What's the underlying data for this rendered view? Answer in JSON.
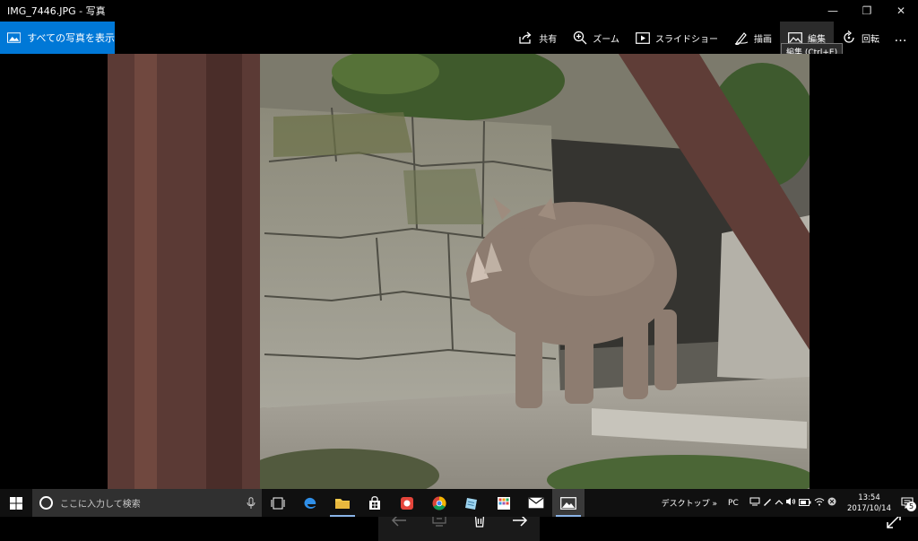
{
  "window": {
    "title": "IMG_7446.JPG - 写真",
    "minimize_glyph": "—",
    "restore_glyph": "❐",
    "close_glyph": "✕"
  },
  "toolbar": {
    "show_all_label": "すべての写真を表示",
    "share_label": "共有",
    "zoom_label": "ズーム",
    "slideshow_label": "スライドショー",
    "draw_label": "描画",
    "edit_label": "編集",
    "rotate_label": "回転",
    "more_label": "…",
    "accent_color": "#0078d7"
  },
  "tooltip": {
    "text": "編集 (Ctrl+E)"
  },
  "viewer": {
    "photo_icon": "photo-image",
    "filmstrip": {
      "prev_icon": "arrow-left-icon",
      "info_icon": "details-icon",
      "delete_icon": "trash-icon",
      "next_icon": "arrow-right-icon"
    },
    "fullscreen_icon": "expand-icon"
  },
  "taskbar": {
    "search_placeholder": "ここに入力して検索",
    "desktop_label": "デスクトップ",
    "chevron_label": "»",
    "pc_label": "PC",
    "time": "13:54",
    "date": "2017/10/14",
    "notification_count": "5"
  }
}
